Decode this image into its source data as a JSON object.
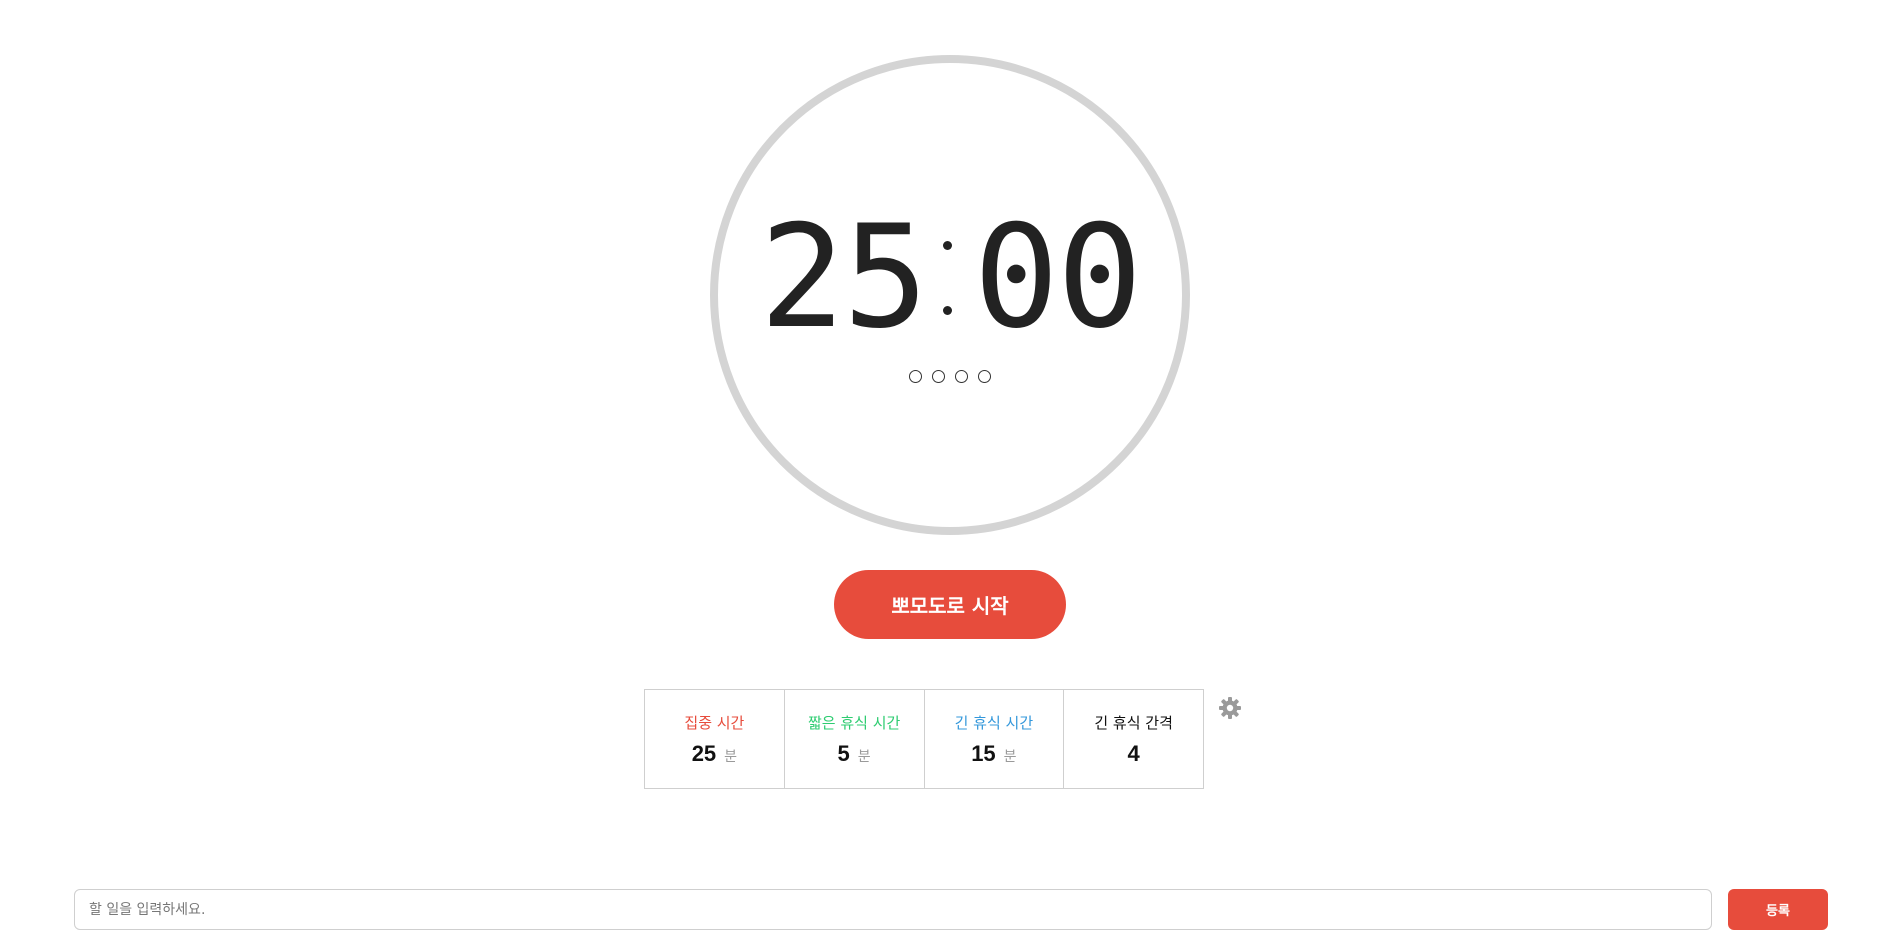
{
  "colors": {
    "accent": "#e74c3c",
    "ring": "#d4d4d4",
    "focus_label": "#e74c3c",
    "short_break_label": "#2ecc71",
    "long_break_label": "#3498db",
    "interval_label": "#111111"
  },
  "timer": {
    "minutes": "25",
    "seconds": "00",
    "cycles_total": 4,
    "cycles_completed": 0
  },
  "start_button": {
    "label": "뽀모도로 시작"
  },
  "settings": {
    "focus": {
      "label": "집중 시간",
      "value": "25",
      "unit": "분"
    },
    "short_break": {
      "label": "짧은 휴식 시간",
      "value": "5",
      "unit": "분"
    },
    "long_break": {
      "label": "긴 휴식 시간",
      "value": "15",
      "unit": "분"
    },
    "long_break_interval": {
      "label": "긴 휴식 간격",
      "value": "4"
    },
    "gear_icon": "gear-icon"
  },
  "task": {
    "placeholder": "할 일을 입력하세요.",
    "value": "",
    "submit_label": "등록"
  }
}
